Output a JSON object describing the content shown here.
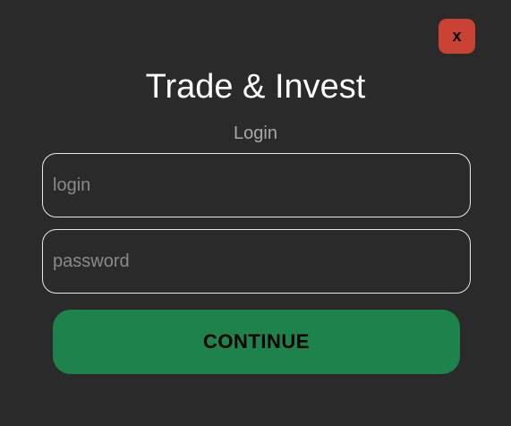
{
  "modal": {
    "close_label": "x",
    "title": "Trade & Invest",
    "subtitle": "Login",
    "login_placeholder": "login",
    "password_placeholder": "password",
    "continue_label": "CONTINUE"
  },
  "colors": {
    "background": "#2a2a2a",
    "close_button": "#c94234",
    "continue_button": "#1e834b",
    "field_border": "#e8e8e8"
  }
}
